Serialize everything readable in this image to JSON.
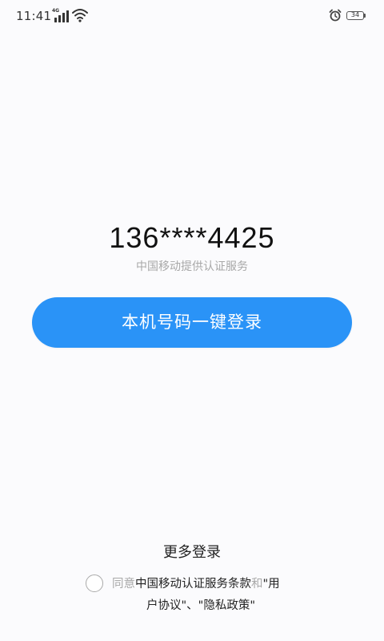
{
  "status_bar": {
    "time": "11:41",
    "network": "4G",
    "battery": "34"
  },
  "main": {
    "phone_number": "136****4425",
    "provider": "中国移动提供认证服务",
    "login_button": "本机号码一键登录"
  },
  "footer": {
    "more_login": "更多登录",
    "agreement": {
      "prefix": "同意",
      "terms_link": "中国移动认证服务条款",
      "and": "和",
      "user_agreement_part1": "\"用",
      "user_agreement_part2": "户协议\"、",
      "privacy_policy": "\"隐私政策\""
    }
  },
  "colors": {
    "accent": "#2a93f7",
    "muted_text": "#a8a8a8",
    "background": "#fbfbfd"
  }
}
